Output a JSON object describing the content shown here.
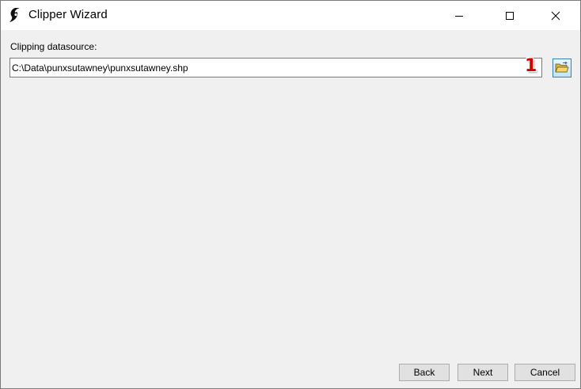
{
  "window": {
    "title": "Clipper Wizard",
    "icon": "clipper-app-icon",
    "controls": {
      "minimize_icon": "minimize-icon",
      "maximize_icon": "maximize-icon",
      "close_icon": "close-icon"
    }
  },
  "form": {
    "datasource_label": "Clipping datasource:",
    "datasource_value": "C:\\Data\\punxsutawney\\punxsutawney.shp",
    "browse_icon": "open-folder-icon",
    "annotation_marker": "1",
    "annotation_color": "#d40000"
  },
  "footer": {
    "back_label": "Back",
    "next_label": "Next",
    "cancel_label": "Cancel"
  }
}
